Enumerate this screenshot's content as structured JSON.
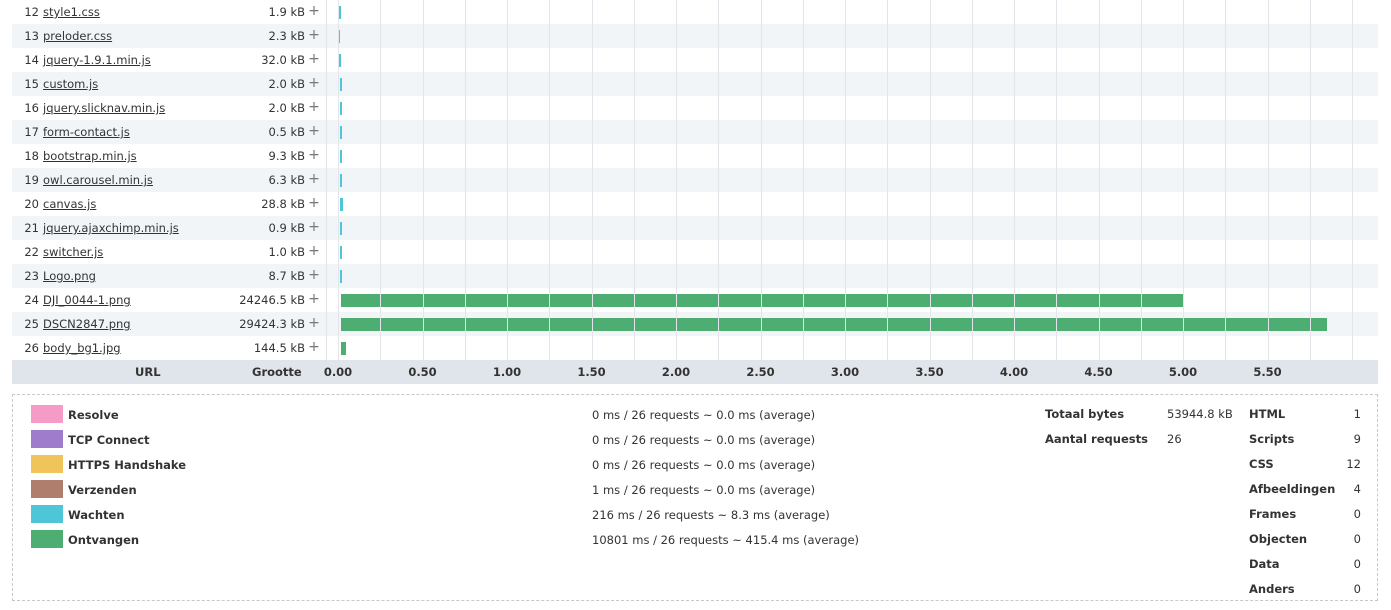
{
  "chart_data": {
    "type": "bar",
    "subtype": "waterfall",
    "x_unit_note": "seconds (request timeline)",
    "xlim": [
      0,
      6.2
    ],
    "x_ticks": [
      "0.00",
      "0.50",
      "1.00",
      "1.50",
      "2.00",
      "2.50",
      "3.00",
      "3.50",
      "4.00",
      "4.50",
      "5.00",
      "5.50"
    ],
    "columns": {
      "url": "URL",
      "size": "Grootte"
    },
    "rows": [
      {
        "n": "12",
        "url": "style1.css",
        "size": "1.9 kB",
        "start": 0.0,
        "wait": 0.02,
        "receive": 0.0
      },
      {
        "n": "13",
        "url": "preloder.css",
        "size": "2.3 kB",
        "start": 0.0,
        "wait": 0.01,
        "receive": 0.0
      },
      {
        "n": "14",
        "url": "jquery-1.9.1.min.js",
        "size": "32.0 kB",
        "start": 0.0,
        "wait": 0.02,
        "receive": 0.0
      },
      {
        "n": "15",
        "url": "custom.js",
        "size": "2.0 kB",
        "start": 0.01,
        "wait": 0.01,
        "receive": 0.0
      },
      {
        "n": "16",
        "url": "jquery.slicknav.min.js",
        "size": "2.0 kB",
        "start": 0.01,
        "wait": 0.01,
        "receive": 0.0
      },
      {
        "n": "17",
        "url": "form-contact.js",
        "size": "0.5 kB",
        "start": 0.01,
        "wait": 0.01,
        "receive": 0.0
      },
      {
        "n": "18",
        "url": "bootstrap.min.js",
        "size": "9.3 kB",
        "start": 0.01,
        "wait": 0.01,
        "receive": 0.0
      },
      {
        "n": "19",
        "url": "owl.carousel.min.js",
        "size": "6.3 kB",
        "start": 0.01,
        "wait": 0.01,
        "receive": 0.0
      },
      {
        "n": "20",
        "url": "canvas.js",
        "size": "28.8 kB",
        "start": 0.01,
        "wait": 0.02,
        "receive": 0.0
      },
      {
        "n": "21",
        "url": "jquery.ajaxchimp.min.js",
        "size": "0.9 kB",
        "start": 0.01,
        "wait": 0.01,
        "receive": 0.0
      },
      {
        "n": "22",
        "url": "switcher.js",
        "size": "1.0 kB",
        "start": 0.01,
        "wait": 0.01,
        "receive": 0.0
      },
      {
        "n": "23",
        "url": "Logo.png",
        "size": "8.7 kB",
        "start": 0.01,
        "wait": 0.01,
        "receive": 0.0
      },
      {
        "n": "24",
        "url": "DJI_0044-1.png",
        "size": "24246.5 kB",
        "start": 0.02,
        "wait": 0.0,
        "receive": 4.98
      },
      {
        "n": "25",
        "url": "DSCN2847.png",
        "size": "29424.3 kB",
        "start": 0.02,
        "wait": 0.0,
        "receive": 5.83
      },
      {
        "n": "26",
        "url": "body_bg1.jpg",
        "size": "144.5 kB",
        "start": 0.02,
        "wait": 0.0,
        "receive": 0.03
      }
    ]
  },
  "colors": {
    "resolve": "#f59bc8",
    "connect": "#a07ccc",
    "handshake": "#efc45a",
    "send": "#b07e6d",
    "wait": "#4ec6d8",
    "receive": "#4eae72"
  },
  "legend": [
    {
      "key": "resolve",
      "label": "Resolve",
      "stat": "0 ms / 26 requests ~ 0.0 ms (average)"
    },
    {
      "key": "connect",
      "label": "TCP Connect",
      "stat": "0 ms / 26 requests ~ 0.0 ms (average)"
    },
    {
      "key": "handshake",
      "label": "HTTPS Handshake",
      "stat": "0 ms / 26 requests ~ 0.0 ms (average)"
    },
    {
      "key": "send",
      "label": "Verzenden",
      "stat": "1 ms / 26 requests ~ 0.0 ms (average)"
    },
    {
      "key": "wait",
      "label": "Wachten",
      "stat": "216 ms / 26 requests ~ 8.3 ms (average)"
    },
    {
      "key": "receive",
      "label": "Ontvangen",
      "stat": "10801 ms / 26 requests ~ 415.4 ms (average)"
    }
  ],
  "summary": [
    {
      "label": "Totaal bytes",
      "value": "53944.8 kB"
    },
    {
      "label": "Aantal requests",
      "value": "26"
    }
  ],
  "types": [
    {
      "label": "HTML",
      "value": "1"
    },
    {
      "label": "Scripts",
      "value": "9"
    },
    {
      "label": "CSS",
      "value": "12"
    },
    {
      "label": "Afbeeldingen",
      "value": "4"
    },
    {
      "label": "Frames",
      "value": "0"
    },
    {
      "label": "Objecten",
      "value": "0"
    },
    {
      "label": "Data",
      "value": "0"
    },
    {
      "label": "Anders",
      "value": "0"
    }
  ]
}
